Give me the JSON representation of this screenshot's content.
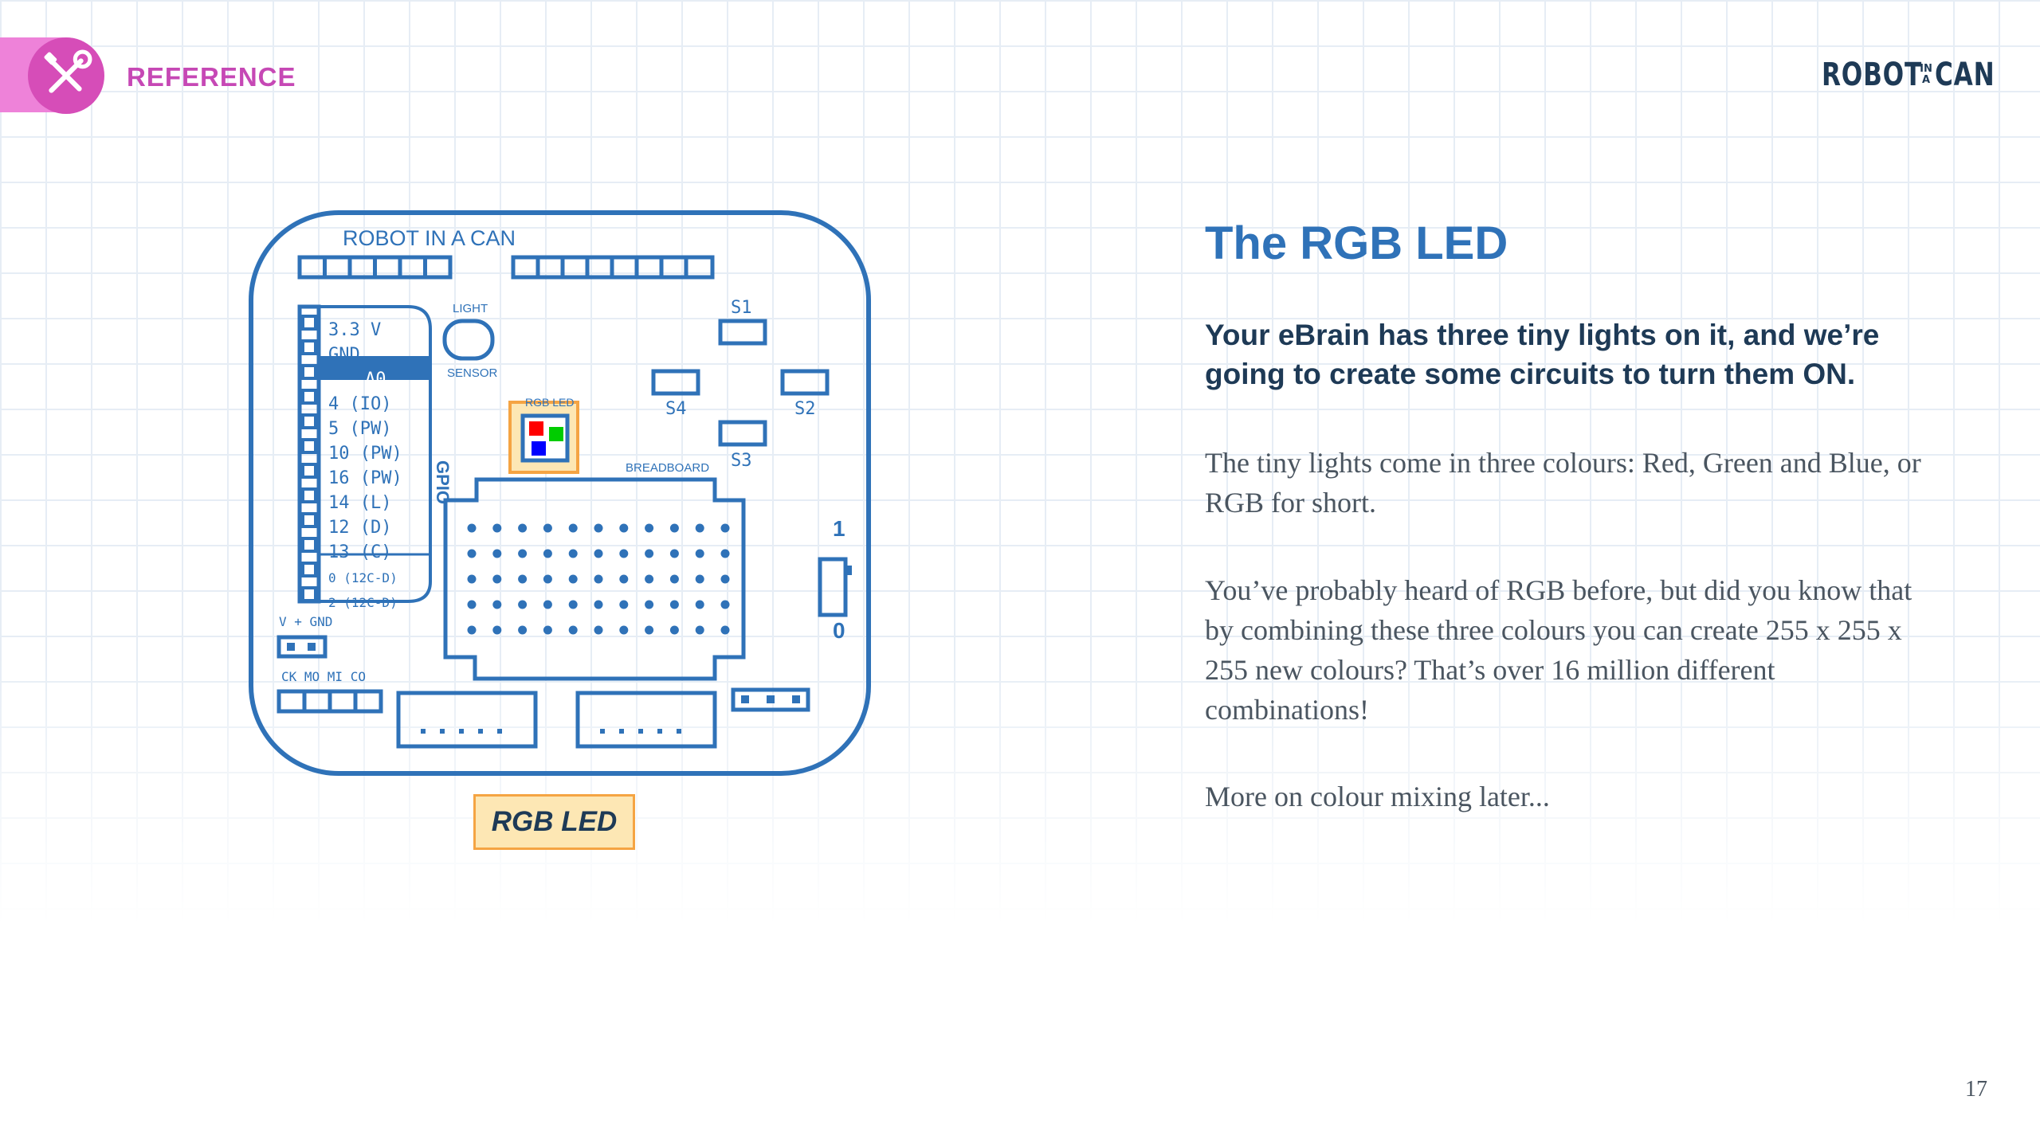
{
  "header": {
    "section_label": "REFERENCE",
    "section_icon": "tools-icon",
    "logo": {
      "word1": "ROBOT",
      "small_top": "IN",
      "small_bottom": "A",
      "word2": "CAN"
    }
  },
  "board": {
    "title": "ROBOT IN A CAN",
    "pins": [
      "3.3 V",
      "GND",
      "A0",
      "4 (IO)",
      "5 (PW)",
      "10 (PW)",
      "16 (PW)",
      "14 (L)",
      "12 (D)",
      "13 (C)",
      "0 (12C-D)",
      "2 (12C-D)"
    ],
    "highlight_pin": "A0",
    "gpio_label": "GPIO",
    "light_label": "LIGHT",
    "sensor_label": "SENSOR",
    "rgb_label": "RGB LED",
    "breadboard_label": "BREADBOARD",
    "switches": [
      "S1",
      "S2",
      "S3",
      "S4"
    ],
    "toggle_on": "1",
    "toggle_off": "0",
    "power_label": "V + GND",
    "bottom_pins_label": "CK MO MI CO",
    "colors": {
      "outline": "#2f72b8",
      "highlight_bg": "#fde7b4",
      "highlight_border": "#f5a443",
      "led_red": "#ff0000",
      "led_green": "#00cc00",
      "led_blue": "#0000ff"
    }
  },
  "badge": {
    "label": "RGB LED"
  },
  "content": {
    "title": "The RGB LED",
    "lead": "Your eBrain has three tiny lights on it, and we’re going to create some circuits to turn them ON.",
    "paragraphs": [
      "The tiny lights come in three colours: Red, Green and Blue, or RGB for short.",
      "You’ve probably heard of RGB before, but did you know that by combining these three colours you can create 255 x 255 x 255 new colours? That’s over 16 million different combinations!",
      "More on colour mixing later..."
    ]
  },
  "page_number": "17"
}
